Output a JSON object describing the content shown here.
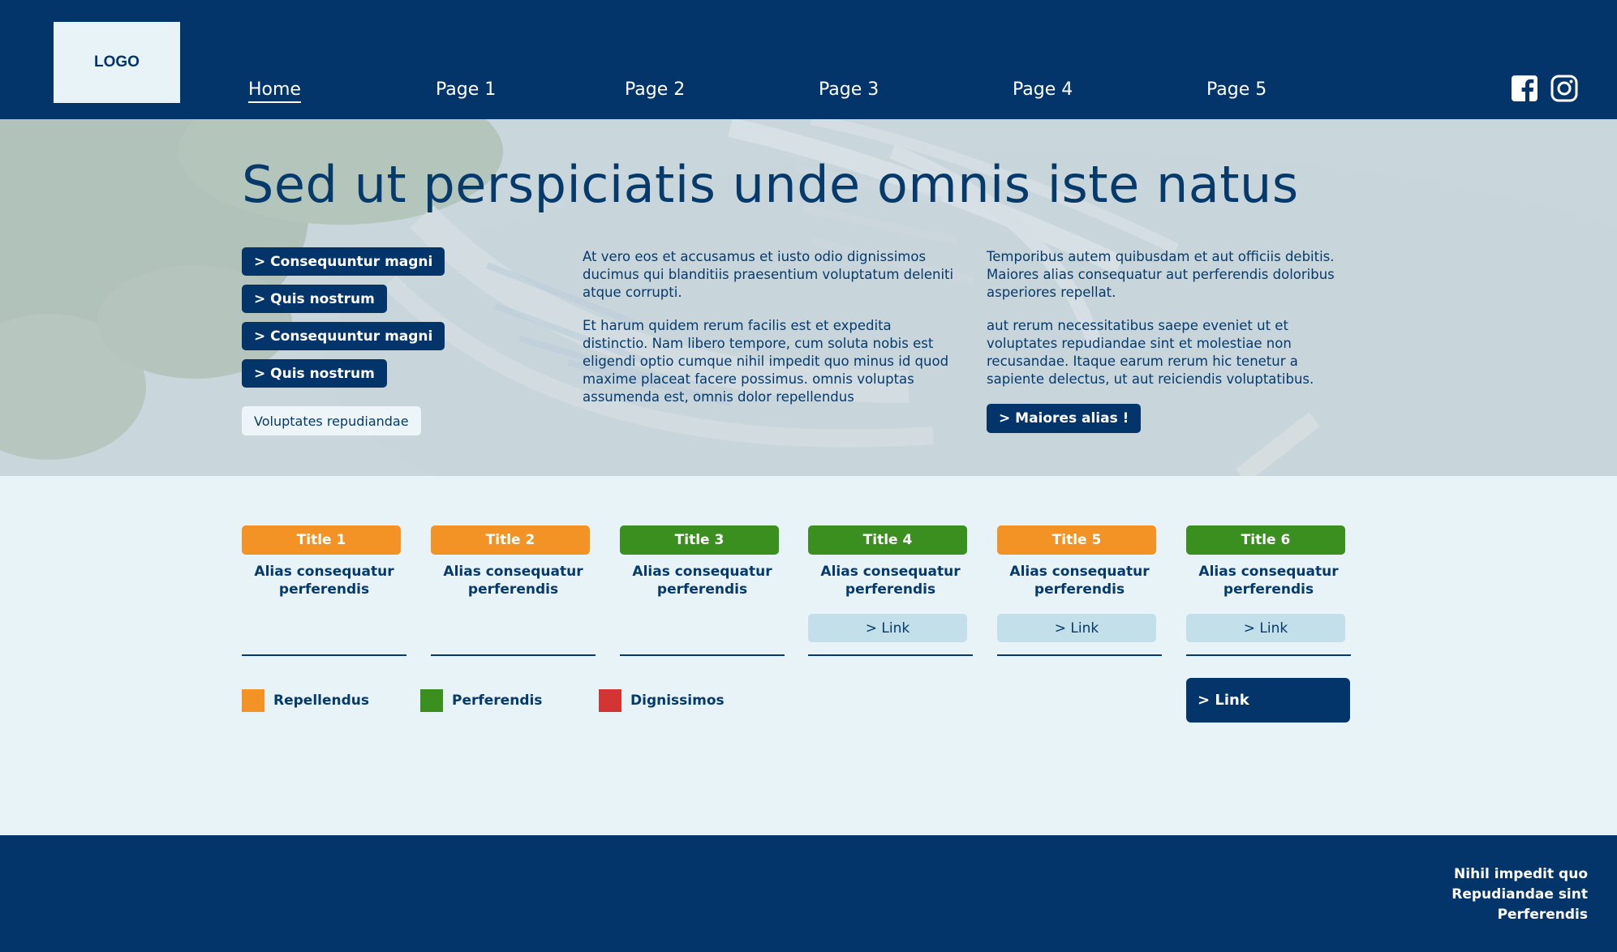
{
  "header": {
    "logo": "LOGO",
    "nav": [
      {
        "label": "Home",
        "active": true
      },
      {
        "label": "Page 1"
      },
      {
        "label": "Page 2"
      },
      {
        "label": "Page 3"
      },
      {
        "label": "Page 4"
      },
      {
        "label": "Page 5"
      }
    ],
    "social": [
      "facebook-icon",
      "instagram-icon"
    ]
  },
  "hero": {
    "title": "Sed ut perspiciatis unde omnis iste natus",
    "side_buttons": [
      "> Consequuntur magni",
      "> Quis nostrum",
      "> Consequuntur magni",
      "> Quis nostrum"
    ],
    "light_button": "Voluptates repudiandae",
    "col1_p1": "At vero eos et accusamus et iusto odio dignissimos ducimus qui blanditiis praesentium voluptatum deleniti atque corrupti.",
    "col1_p2": "Et harum quidem rerum facilis est et expedita distinctio. Nam libero tempore, cum soluta nobis est eligendi optio cumque nihil impedit quo minus id quod maxime placeat facere possimus. omnis voluptas assumenda est, omnis dolor repellendus",
    "col2_p1": "Temporibus autem quibusdam et aut officiis debitis. Maiores alias consequatur aut perferendis doloribus asperiores repellat.",
    "col2_p2": "aut rerum necessitatibus saepe eveniet ut et voluptates repudiandae sint et molestiae non recusandae. Itaque earum rerum hic tenetur a sapiente delectus, ut aut reiciendis voluptatibus.",
    "cta": "> Maiores alias !"
  },
  "cards": [
    {
      "title": "Title 1",
      "desc": "Alias consequatur perferendis",
      "color": "#f39325",
      "link": null
    },
    {
      "title": "Title 2",
      "desc": "Alias consequatur perferendis",
      "color": "#f39325",
      "link": null
    },
    {
      "title": "Title 3",
      "desc": "Alias consequatur perferendis",
      "color": "#3b8f1e",
      "link": null
    },
    {
      "title": "Title 4",
      "desc": "Alias consequatur perferendis",
      "color": "#3b8f1e",
      "link": "> Link"
    },
    {
      "title": "Title 5",
      "desc": "Alias consequatur perferendis",
      "color": "#f39325",
      "link": "> Link"
    },
    {
      "title": "Title 6",
      "desc": "Alias consequatur perferendis",
      "color": "#3b8f1e",
      "link": "> Link"
    }
  ],
  "legend": [
    {
      "label": "Repellendus",
      "color": "#f39325"
    },
    {
      "label": "Perferendis",
      "color": "#3b8f1e"
    },
    {
      "label": "Dignissimos",
      "color": "#d33535"
    }
  ],
  "big_link": "> Link",
  "footer": {
    "lines": [
      "Nihil impedit quo",
      "Repudiandae sint",
      "Perferendis"
    ]
  }
}
